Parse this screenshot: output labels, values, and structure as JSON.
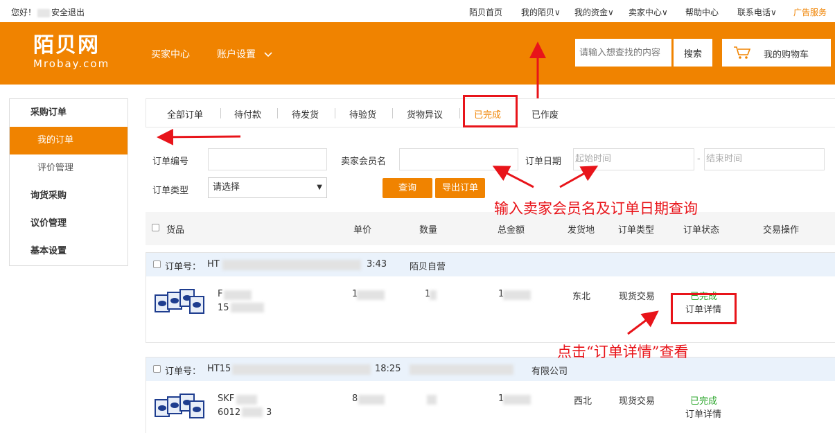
{
  "topbar": {
    "greeting": "您好！",
    "logout": "安全退出",
    "nav": [
      "陌贝首页",
      "我的陌贝∨",
      "我的资金∨",
      "卖家中心∨",
      "帮助中心",
      "联系电话∨"
    ],
    "ad": "广告服务"
  },
  "header": {
    "logo_cn": "陌贝网",
    "logo_en": "Mrobay.com",
    "nav": [
      "买家中心",
      "账户设置"
    ],
    "search": {
      "placeholder": "请输入想查找的内容",
      "button": "搜索"
    },
    "cart": "我的购物车"
  },
  "sidebar": {
    "purchase": "采购订单",
    "my_orders": "我的订单",
    "reviews": "评价管理",
    "inquiry": "询货采购",
    "negotiation": "议价管理",
    "settings": "基本设置"
  },
  "tabs": [
    "全部订单",
    "待付款",
    "待发货",
    "待验货",
    "货物异议",
    "已完成",
    "已作废"
  ],
  "filters": {
    "order_no_label": "订单编号",
    "seller_label": "卖家会员名",
    "date_label": "订单日期",
    "start_placeholder": "起始时间",
    "dash": "-",
    "end_placeholder": "结束时间",
    "type_label": "订单类型",
    "type_selected": "请选择",
    "query_button": "查询",
    "export_button": "导出订单"
  },
  "table_headers": [
    "货品",
    "单价",
    "数量",
    "总金额",
    "发货地",
    "订单类型",
    "订单状态",
    "交易操作"
  ],
  "orders": [
    {
      "order_label": "订单号：",
      "order_no_prefix": "HT",
      "time_suffix": "3:43",
      "seller": "陌贝自营",
      "product_line1": "F",
      "product_line2": "15",
      "price": "1",
      "qty": "1",
      "total": "1",
      "origin": "东北",
      "type": "现货交易",
      "status": "已完成",
      "detail": "订单详情"
    },
    {
      "order_label": "订单号：",
      "order_no_prefix": "HT15",
      "time_suffix": "18:25",
      "seller": "有限公司",
      "product_line1": "SKF",
      "product_line2": "6012",
      "product_line2_suffix": "3",
      "price": "8",
      "qty": "",
      "total": "1",
      "origin": "西北",
      "type": "现货交易",
      "status": "已完成",
      "detail": "订单详情"
    }
  ],
  "annotations": {
    "query_hint": "输入卖家会员名及订单日期查询",
    "detail_hint": "点击“订单详情”查看"
  },
  "colors": {
    "brand": "#f08300",
    "annotation": "#e8141a",
    "status_done": "#2aa52a"
  }
}
